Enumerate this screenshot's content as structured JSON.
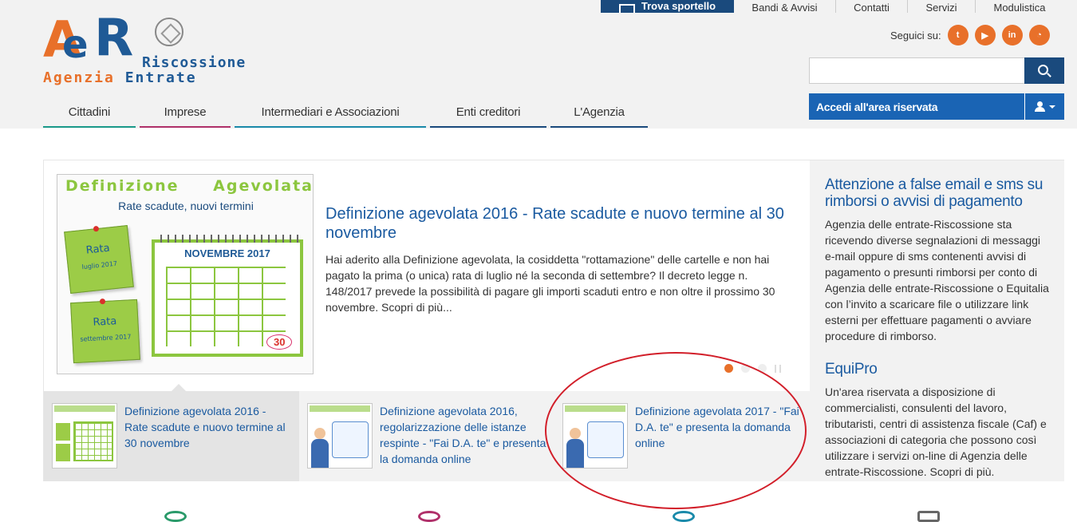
{
  "header": {
    "topnav": {
      "trova_sportello": "Trova sportello",
      "bandi": "Bandi & Avvisi",
      "contatti": "Contatti",
      "servizi": "Servizi",
      "modulistica": "Modulistica"
    },
    "logo": {
      "risc": "Riscossione",
      "agenzia": "Agenzia",
      "entrate": "Entrate"
    },
    "follow_label": "Seguici su:",
    "social": [
      "twitter-icon",
      "youtube-icon",
      "linkedin-icon",
      "rss-icon"
    ],
    "search": {
      "placeholder": "",
      "value": ""
    },
    "login_label": "Accedi all'area riservata",
    "nav": [
      {
        "label": "Cittadini",
        "accent": "#1a9a8a"
      },
      {
        "label": "Imprese",
        "accent": "#b0306a"
      },
      {
        "label": "Intermediari e Associazioni",
        "accent": "#1a8aaa"
      },
      {
        "label": "Enti creditori",
        "accent": "#1a4a7d"
      },
      {
        "label": "L'Agenzia",
        "accent": "#1a4a7d"
      }
    ]
  },
  "featured": {
    "image": {
      "title_a": "Definizione",
      "title_b": "Agevolata",
      "subtitle": "Rate scadute, nuovi termini",
      "note1_title": "Rata",
      "note1_sub": "luglio 2017",
      "note2_title": "Rata",
      "note2_sub": "settembre 2017",
      "calendar_title": "NOVEMBRE 2017",
      "day": "30"
    },
    "title": "Definizione agevolata 2016 - Rate scadute e nuovo termine al 30 novembre",
    "description": "Hai aderito alla Definizione agevolata, la cosiddetta \"rottamazione\" delle cartelle e non hai pagato la prima (o unica) rata di luglio né la seconda di settembre? Il decreto legge n. 148/2017 prevede la possibilità di pagare gli importi scaduti entro e non oltre il prossimo 30 novembre. Scopri di più..."
  },
  "thumbs": [
    {
      "label": "Definizione agevolata 2016 - Rate scadute e nuovo termine al 30 novembre",
      "selected": true
    },
    {
      "label": "Definizione agevolata 2016, regolarizzazione delle istanze respinte - \"Fai D.A. te\" e presenta la domanda online",
      "selected": false
    },
    {
      "label": "Definizione agevolata 2017 - \"Fai D.A. te\" e presenta la domanda online",
      "selected": false
    }
  ],
  "sidebar": {
    "news1_title": "Attenzione a false email e sms su rimborsi o avvisi di pagamento",
    "news1_text": "Agenzia delle entrate-Riscossione sta ricevendo diverse segnalazioni di messaggi e-mail oppure di sms contenenti avvisi di pagamento o presunti rimborsi per conto di Agenzia delle entrate-Riscossione o Equitalia con l’invito a scaricare file o utilizzare link esterni per effettuare pagamenti o avviare procedure di rimborso.",
    "news2_title": "EquiPro",
    "news2_text": "Un'area riservata a disposizione di commercialisti, consulenti del lavoro, tributaristi, centri di assistenza fiscale (Caf) e associazioni di categoria che possono così utilizzare i servizi on-line di Agenzia delle entrate-Riscossione. Scopri di più."
  },
  "colors": {
    "brand_blue": "#1a4a7d",
    "orange": "#e8702a",
    "highlight_red": "#d21f2a"
  }
}
